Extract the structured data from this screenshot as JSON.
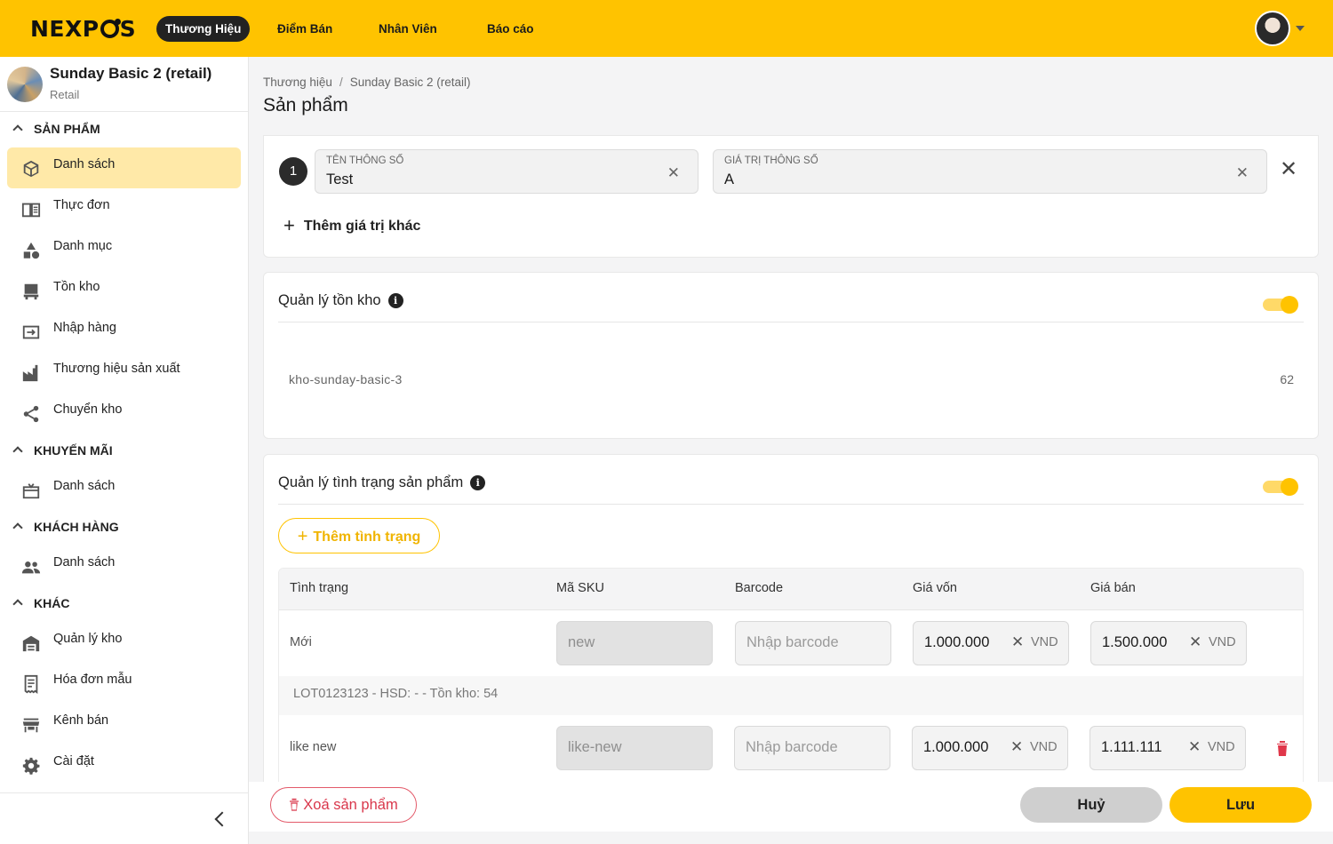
{
  "topbar": {
    "logo_text_a": "NEXP",
    "logo_text_b": "S",
    "nav": [
      {
        "label": "Thương Hiệu",
        "active": true
      },
      {
        "label": "Điểm Bán",
        "active": false
      },
      {
        "label": "Nhân Viên",
        "active": false
      },
      {
        "label": "Báo cáo",
        "active": false
      }
    ],
    "brand_color": "#ffc300"
  },
  "sidebar": {
    "brand_name": "Sunday Basic 2 (retail)",
    "brand_type": "Retail",
    "sections": [
      {
        "title": "SẢN PHẨM",
        "items": [
          {
            "label": "Danh sách",
            "icon": "box-icon",
            "active": true
          },
          {
            "label": "Thực đơn",
            "icon": "menu-book-icon"
          },
          {
            "label": "Danh mục",
            "icon": "category-icon"
          },
          {
            "label": "Tồn kho",
            "icon": "inventory-icon"
          },
          {
            "label": "Nhập hàng",
            "icon": "import-icon"
          },
          {
            "label": "Thương hiệu sản xuất",
            "icon": "factory-icon"
          },
          {
            "label": "Chuyển kho",
            "icon": "share-icon"
          }
        ]
      },
      {
        "title": "KHUYẾN MÃI",
        "items": [
          {
            "label": "Danh sách",
            "icon": "gift-icon"
          }
        ]
      },
      {
        "title": "KHÁCH HÀNG",
        "items": [
          {
            "label": "Danh sách",
            "icon": "people-icon"
          }
        ]
      },
      {
        "title": "KHÁC",
        "items": [
          {
            "label": "Quản lý kho",
            "icon": "warehouse-icon"
          },
          {
            "label": "Hóa đơn mẫu",
            "icon": "receipt-icon"
          },
          {
            "label": "Kênh bán",
            "icon": "store-icon"
          },
          {
            "label": "Cài đặt",
            "icon": "gear-icon"
          }
        ]
      }
    ]
  },
  "main": {
    "breadcrumb": [
      "Thương hiệu",
      "Sunday Basic 2 (retail)"
    ],
    "title": "Sản phẩm",
    "attribute": {
      "index": "1",
      "name_label": "TÊN THÔNG SỐ",
      "name_value": "Test",
      "value_label": "GIÁ TRỊ THÔNG SỐ",
      "value_value": "A",
      "add_label": "Thêm giá trị khác"
    },
    "inventory": {
      "title": "Quản lý tồn kho",
      "enabled": true,
      "warehouse": "kho-sunday-basic-3",
      "quantity": "62"
    },
    "conditions": {
      "title": "Quản lý tình trạng sản phẩm",
      "enabled": true,
      "add_label": "Thêm tình trạng",
      "columns": [
        "Tình trạng",
        "Mã SKU",
        "Barcode",
        "Giá vốn",
        "Giá bán"
      ],
      "barcode_placeholder": "Nhập barcode",
      "currency": "VND",
      "rows": [
        {
          "status": "Mới",
          "sku": "new",
          "cost": "1.000.000",
          "price": "1.500.000",
          "lot": "LOT0123123 - HSD: - - Tồn kho: 54"
        },
        {
          "status": "like new",
          "sku": "like-new",
          "cost": "1.000.000",
          "price": "1.111.111"
        }
      ]
    }
  },
  "footer": {
    "delete_label": "Xoá sản phẩm",
    "cancel_label": "Huỷ",
    "save_label": "Lưu"
  }
}
